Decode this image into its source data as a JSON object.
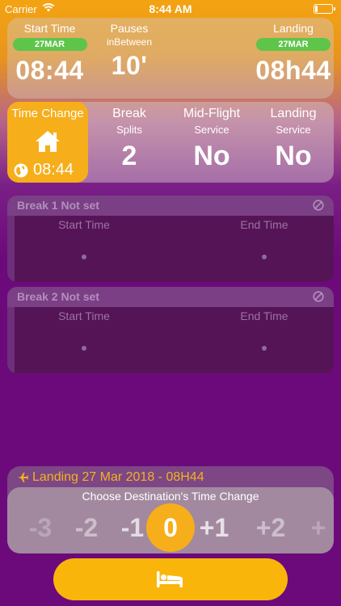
{
  "status": {
    "carrier": "Carrier",
    "time": "8:44 AM"
  },
  "summary": {
    "start": {
      "label": "Start Time",
      "date": "27MAR",
      "value": "08:44"
    },
    "pauses": {
      "label": "Pauses",
      "sub": "inBetween",
      "value": "10'"
    },
    "landing": {
      "label": "Landing",
      "date": "27MAR",
      "value": "08h44"
    }
  },
  "settings": {
    "time_change": {
      "label": "Time Change",
      "value": "08:44"
    },
    "break": {
      "label": "Break",
      "sub": "Splits",
      "value": "2"
    },
    "midflight": {
      "label": "Mid-Flight",
      "sub": "Service",
      "value": "No"
    },
    "landing_service": {
      "label": "Landing",
      "sub": "Service",
      "value": "No"
    }
  },
  "breaks": [
    {
      "title": "Break 1 Not set",
      "start_label": "Start Time",
      "end_label": "End Time"
    },
    {
      "title": "Break 2 Not set",
      "start_label": "Start Time",
      "end_label": "End Time"
    }
  ],
  "landing_panel": {
    "title": "Landing 27 Mar 2018 - 08H44",
    "prompt": "Choose Destination's Time Change",
    "options": [
      "-3",
      "-2",
      "-1",
      "0",
      "+1",
      "+2",
      "+"
    ],
    "selected": "0"
  },
  "icons": {
    "home": "home-icon",
    "globe": "globe-icon",
    "ban": "ban-icon",
    "plane": "plane-icon",
    "bed": "bed-icon",
    "wifi": "wifi-icon",
    "battery": "battery-icon"
  },
  "colors": {
    "accent": "#f6ae1a",
    "pill": "#5fc44a",
    "background": "#6c0a7c",
    "landing_title": "#f2b21d"
  }
}
